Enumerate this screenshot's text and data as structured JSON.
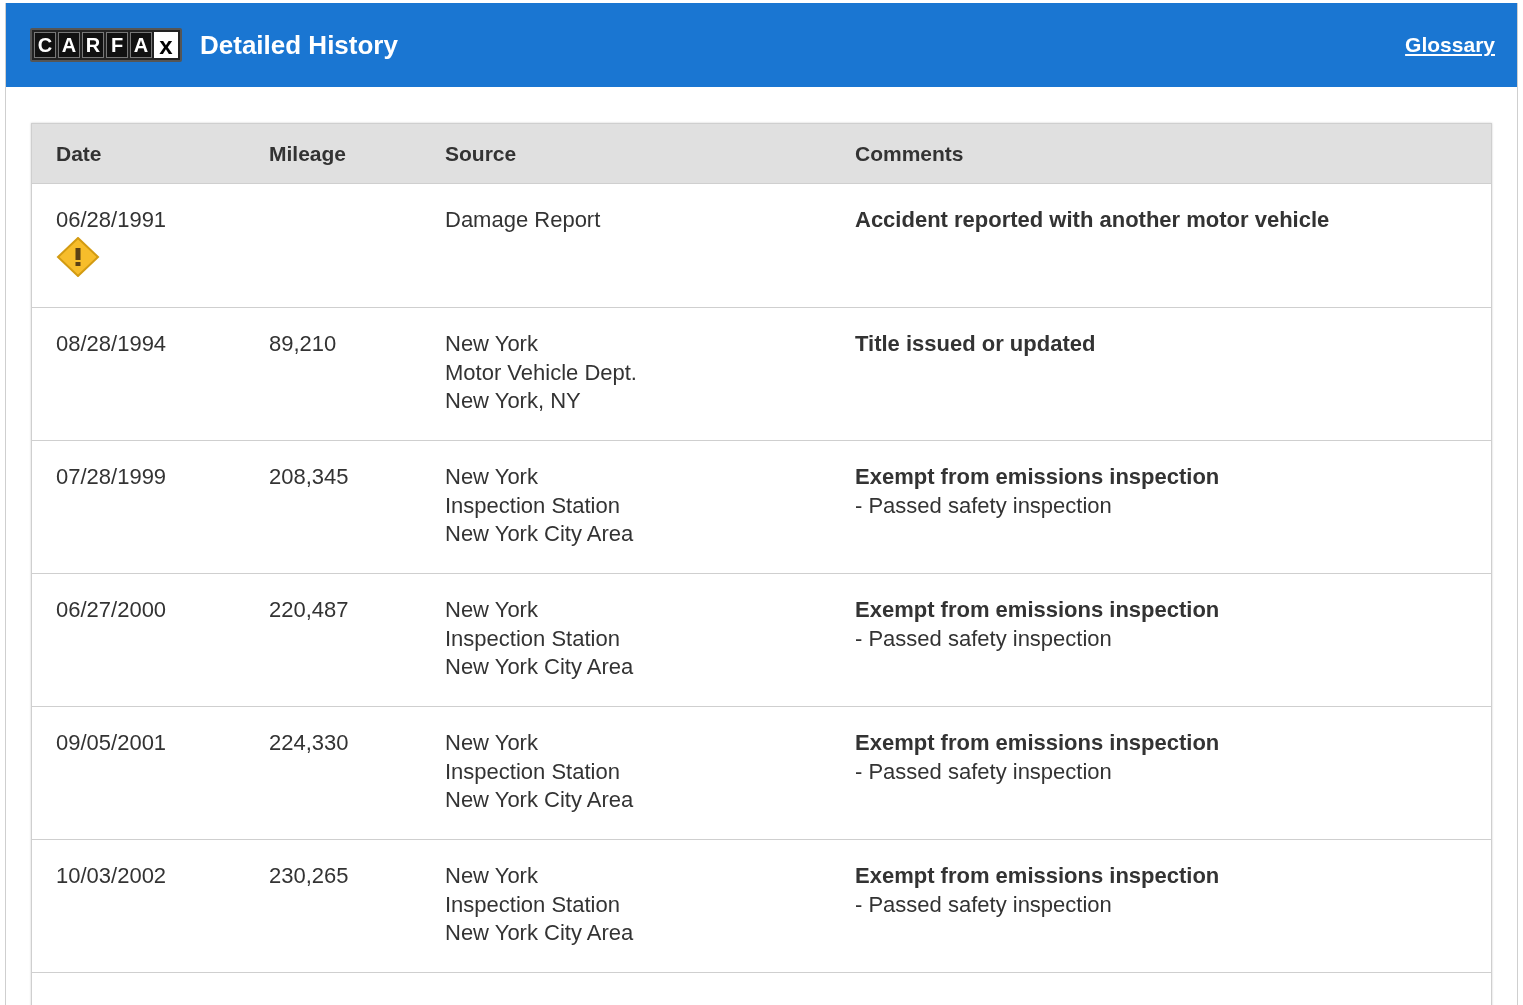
{
  "header": {
    "logo_letters": [
      "C",
      "A",
      "R",
      "F",
      "A",
      "x"
    ],
    "title": "Detailed History",
    "link": "Glossary"
  },
  "table": {
    "columns": [
      "Date",
      "Mileage",
      "Source",
      "Comments"
    ],
    "rows": [
      {
        "date": "06/28/1991",
        "alert": true,
        "mileage": "",
        "source": [
          "Damage Report"
        ],
        "comment": "Accident reported with another motor vehicle",
        "details": []
      },
      {
        "date": "08/28/1994",
        "alert": false,
        "mileage": "89,210",
        "source": [
          "New York",
          "Motor Vehicle Dept.",
          "New York, NY"
        ],
        "comment": "Title issued or updated",
        "details": []
      },
      {
        "date": "07/28/1999",
        "alert": false,
        "mileage": "208,345",
        "source": [
          "New York",
          "Inspection Station",
          "New York City Area"
        ],
        "comment": "Exempt from emissions inspection",
        "details": [
          "- Passed safety inspection"
        ]
      },
      {
        "date": "06/27/2000",
        "alert": false,
        "mileage": "220,487",
        "source": [
          "New York",
          "Inspection Station",
          "New York City Area"
        ],
        "comment": "Exempt from emissions inspection",
        "details": [
          "- Passed safety inspection"
        ]
      },
      {
        "date": "09/05/2001",
        "alert": false,
        "mileage": "224,330",
        "source": [
          "New York",
          "Inspection Station",
          "New York City Area"
        ],
        "comment": "Exempt from emissions inspection",
        "details": [
          "- Passed safety inspection"
        ]
      },
      {
        "date": "10/03/2002",
        "alert": false,
        "mileage": "230,265",
        "source": [
          "New York",
          "Inspection Station",
          "New York City Area"
        ],
        "comment": "Exempt from emissions inspection",
        "details": [
          "- Passed safety inspection"
        ]
      }
    ]
  }
}
